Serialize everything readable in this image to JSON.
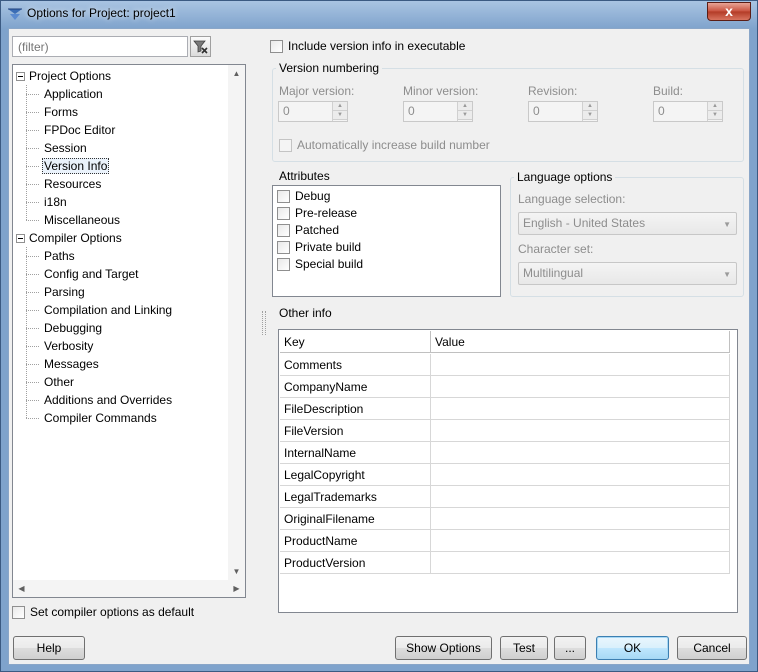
{
  "window": {
    "title": "Options for Project: project1",
    "close_label": "x"
  },
  "filter": {
    "placeholder": "(filter)"
  },
  "tree": {
    "groups": [
      {
        "label": "Project Options",
        "items": [
          "Application",
          "Forms",
          "FPDoc Editor",
          "Session",
          "Version Info",
          "Resources",
          "i18n",
          "Miscellaneous"
        ]
      },
      {
        "label": "Compiler Options",
        "items": [
          "Paths",
          "Config and Target",
          "Parsing",
          "Compilation and Linking",
          "Debugging",
          "Verbosity",
          "Messages",
          "Other",
          "Additions and Overrides",
          "Compiler Commands"
        ]
      }
    ],
    "selected": "Version Info"
  },
  "include_version_label": "Include version info in executable",
  "version_numbering": {
    "title": "Version numbering",
    "major_label": "Major version:",
    "minor_label": "Minor version:",
    "revision_label": "Revision:",
    "build_label": "Build:",
    "major_value": "0",
    "minor_value": "0",
    "revision_value": "0",
    "build_value": "0",
    "auto_increase_label": "Automatically increase build number"
  },
  "attributes": {
    "title": "Attributes",
    "items": [
      "Debug",
      "Pre-release",
      "Patched",
      "Private build",
      "Special build"
    ]
  },
  "language_options": {
    "title": "Language options",
    "language_label": "Language selection:",
    "language_value": "English - United States",
    "charset_label": "Character set:",
    "charset_value": "Multilingual"
  },
  "other_info": {
    "title": "Other info",
    "col_key": "Key",
    "col_value": "Value",
    "rows": [
      {
        "key": "Comments",
        "value": ""
      },
      {
        "key": "CompanyName",
        "value": ""
      },
      {
        "key": "FileDescription",
        "value": ""
      },
      {
        "key": "FileVersion",
        "value": ""
      },
      {
        "key": "InternalName",
        "value": ""
      },
      {
        "key": "LegalCopyright",
        "value": ""
      },
      {
        "key": "LegalTrademarks",
        "value": ""
      },
      {
        "key": "OriginalFilename",
        "value": ""
      },
      {
        "key": "ProductName",
        "value": ""
      },
      {
        "key": "ProductVersion",
        "value": ""
      }
    ]
  },
  "set_default_label": "Set compiler options as default",
  "buttons": {
    "help": "Help",
    "show_options": "Show Options",
    "test": "Test",
    "more": "...",
    "ok": "OK",
    "cancel": "Cancel"
  }
}
